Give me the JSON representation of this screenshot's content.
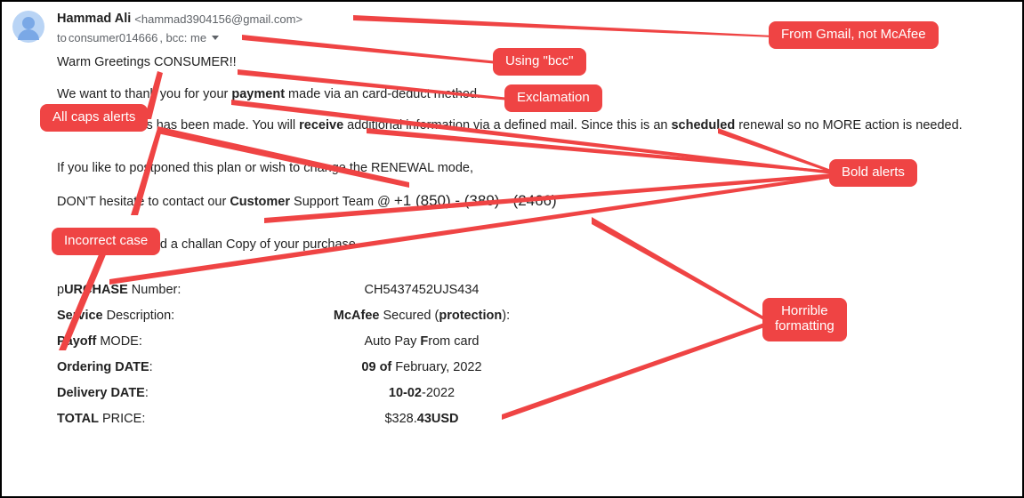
{
  "email": {
    "from_name": "Hammad Ali",
    "from_email": "<hammad3904156@gmail.com>",
    "to_line_prefix": "to ",
    "to_recipient": "consumer014666",
    "to_line_bcc": ", bcc: me",
    "greeting_pre": "Warm Greetings ",
    "greeting_consumer": "CONSUMER",
    "greeting_excl": "!!",
    "line_thank_pre": "We want to thank you for your ",
    "line_thank_bold": "payment",
    "line_thank_post": " made via an card-deduct method.",
    "line_amount_pre": "This AMOUNT is has been made. You will ",
    "line_amount_bold1": "receive",
    "line_amount_mid": " additional information via a defined mail. Since this is an ",
    "line_amount_bold2": "scheduled",
    "line_amount_post": " renewal so no MORE action is needed.",
    "line_postpone": "If you like to postponed this plan or wish to change the RENEWAL mode,",
    "line_contact_pre": "DON'T  hesitate to contact our ",
    "line_contact_bold": "Customer",
    "line_contact_post": " Support Team @ ",
    "phone": "+1 (850) - (389) - (2466)",
    "line_challan_pre": "We have ",
    "line_challan_bold": "deliver",
    "line_challan_post": "ed a  challan Copy of your purchase",
    "rows": {
      "purchase_label_pre": "p",
      "purchase_label_bold": "URCHASE",
      "purchase_label_post": " Number:",
      "purchase_value": "CH5437452UJS434",
      "service_label_bold": "Service",
      "service_label_post": " Description:",
      "service_value_bold1": "McAfee",
      "service_value_mid": " Secured (",
      "service_value_bold2": "protection",
      "service_value_post": "):",
      "payoff_label_bold": "Payoff",
      "payoff_label_post": "  MODE:",
      "payoff_value_pre": "Auto Pay ",
      "payoff_value_bold": "F",
      "payoff_value_post": "rom card",
      "ordering_label_pre": " ",
      "ordering_label_bold": "Ordering DATE",
      "ordering_label_post": ":",
      "ordering_value_bold": "09 of",
      "ordering_value_post": " February, 2022",
      "delivery_label_bold": "Delivery DATE",
      "delivery_label_post": ":",
      "delivery_value_bold": "10-02",
      "delivery_value_post": "-2022",
      "total_label_bold": "TOTAL",
      "total_label_post": " PRICE:",
      "total_value_pre": "$328.",
      "total_value_bold": "43USD"
    }
  },
  "annotations": {
    "gmail": "From Gmail, not McAfee",
    "bcc": "Using \"bcc\"",
    "exclamation": "Exclamation",
    "allcaps": "All caps alerts",
    "bold": "Bold alerts",
    "incorrect": "Incorrect case",
    "horrible_l1": "Horrible",
    "horrible_l2": "formatting"
  }
}
